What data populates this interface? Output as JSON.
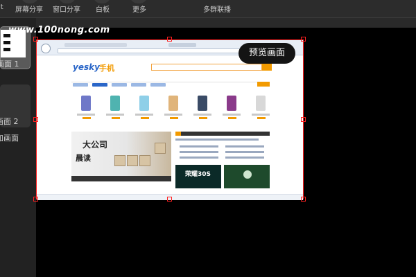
{
  "toolbar": {
    "items": [
      {
        "label": "屏幕分享",
        "icon": "screen-share-icon"
      },
      {
        "label": "窗口分享",
        "icon": "window-share-icon"
      },
      {
        "label": "白板",
        "icon": "whiteboard-icon"
      },
      {
        "label": "更多",
        "icon": "more-icon"
      },
      {
        "label": "多群联播",
        "icon": "multi-group-broadcast-icon"
      }
    ],
    "left_fragment": "it"
  },
  "watermark": "www.100nong.com",
  "sidebar": {
    "scenes": [
      {
        "label": "画面 1"
      },
      {
        "label": "画面 2"
      }
    ],
    "add_label": "加画面"
  },
  "canvas": {
    "preview_button": "预览画面"
  },
  "capture_site": {
    "logo_text": "yesky",
    "logo_cn": "手机",
    "tile1_text": "荣耀30S"
  },
  "colors": {
    "selection_border": "#ff2020",
    "brand_orange": "#f29a00",
    "brand_blue": "#2a66c8"
  }
}
